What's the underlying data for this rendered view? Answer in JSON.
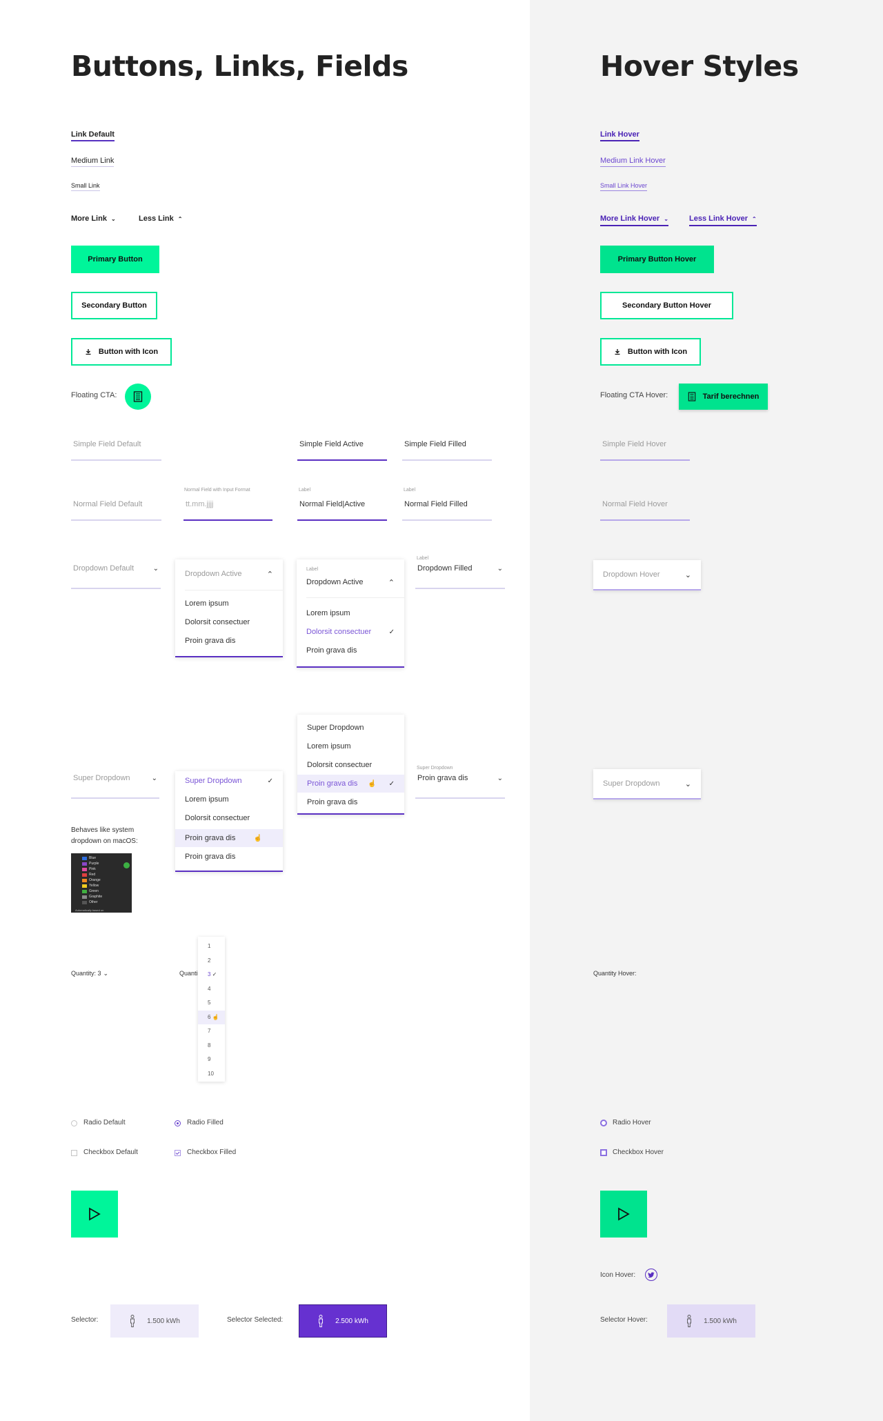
{
  "left": {
    "title": "Buttons, Links, Fields",
    "links": {
      "default": "Link Default",
      "medium": "Medium Link",
      "small": "Small Link",
      "more": "More Link",
      "less": "Less Link"
    },
    "buttons": {
      "primary": "Primary Button",
      "secondary": "Secondary Button",
      "with_icon": "Button with Icon"
    },
    "floating_cta_label": "Floating CTA:",
    "fields": {
      "simple_default": "Simple Field Default",
      "simple_active": "Simple Field Active",
      "simple_filled": "Simple Field Filled",
      "normal_default": "Normal Field Default",
      "normal_format_label": "Normal Field with Input Format",
      "normal_format_value": "tt.mm.jjjj",
      "active_label": "Label",
      "normal_active": "Normal Field|Active",
      "filled_label": "Label",
      "normal_filled": "Normal Field Filled"
    },
    "dropdowns": {
      "default": "Dropdown Default",
      "active": "Dropdown Active",
      "active_items": [
        "Lorem ipsum",
        "Dolorsit consectuer",
        "Proin grava dis"
      ],
      "active2_label": "Label",
      "active2_value": "Dropdown Active",
      "active2_items": [
        "Lorem ipsum",
        "Dolorsit consectuer",
        "Proin grava dis"
      ],
      "filled_label": "Label",
      "filled_value": "Dropdown Filled"
    },
    "super": {
      "default": "Super Dropdown",
      "open_items": [
        "Super Dropdown",
        "Lorem ipsum",
        "Dolorsit consectuer",
        "Proin grava dis",
        "Proin grava dis"
      ],
      "open2_items": [
        "Super Dropdown",
        "Lorem ipsum",
        "Dolorsit consectuer",
        "Proin grava dis",
        "Proin grava dis"
      ],
      "filled_label": "Super Dropdown",
      "filled_value": "Proin grava dis",
      "note": "Behaves like system dropdown on macOS:",
      "mac_colors": [
        {
          "name": "Blue",
          "color": "#2f6fe0"
        },
        {
          "name": "Purple",
          "color": "#8a47c8"
        },
        {
          "name": "Pink",
          "color": "#e04ca0"
        },
        {
          "name": "Red",
          "color": "#e04040"
        },
        {
          "name": "Orange",
          "color": "#f08a20"
        },
        {
          "name": "Yellow",
          "color": "#f0cc20"
        },
        {
          "name": "Green",
          "color": "#40b040"
        },
        {
          "name": "Graphite",
          "color": "#8a8a8a"
        },
        {
          "name": "Other",
          "color": "#555555"
        }
      ],
      "mac_footer": "Automatically based on"
    },
    "quantity": {
      "label": "Quantity: 3",
      "label2": "Quanti",
      "options": [
        "1",
        "2",
        "3",
        "4",
        "5",
        "6",
        "7",
        "8",
        "9",
        "10"
      ],
      "selected": "3",
      "hovered": "6"
    },
    "radio_default": "Radio Default",
    "radio_filled": "Radio Filled",
    "checkbox_default": "Checkbox Default",
    "checkbox_filled": "Checkbox Filled",
    "selector_label": "Selector:",
    "selector_value": "1.500 kWh",
    "selector_selected_label": "Selector Selected:",
    "selector_selected_value": "2.500 kWh"
  },
  "right": {
    "title": "Hover Styles",
    "links": {
      "hover": "Link Hover",
      "medium": "Medium Link Hover",
      "small": "Small Link Hover",
      "more": "More Link Hover",
      "less": "Less Link Hover"
    },
    "buttons": {
      "primary": "Primary Button Hover",
      "secondary": "Secondary Button Hover",
      "with_icon": "Button with Icon"
    },
    "floating_cta_label": "Floating CTA Hover:",
    "floating_cta_button": "Tarif berechnen",
    "simple_field": "Simple Field Hover",
    "normal_field": "Normal Field Hover",
    "dropdown": "Dropdown Hover",
    "super_dropdown": "Super Dropdown",
    "quantity_label": "Quantity Hover:",
    "radio": "Radio Hover",
    "checkbox": "Checkbox Hover",
    "icon_hover": "Icon Hover:",
    "selector_label": "Selector Hover:",
    "selector_value": "1.500 kWh"
  },
  "colors": {
    "accent_green": "#00f59a",
    "accent_purple": "#5a2fc2",
    "panel_gray": "#f3f3f3"
  }
}
